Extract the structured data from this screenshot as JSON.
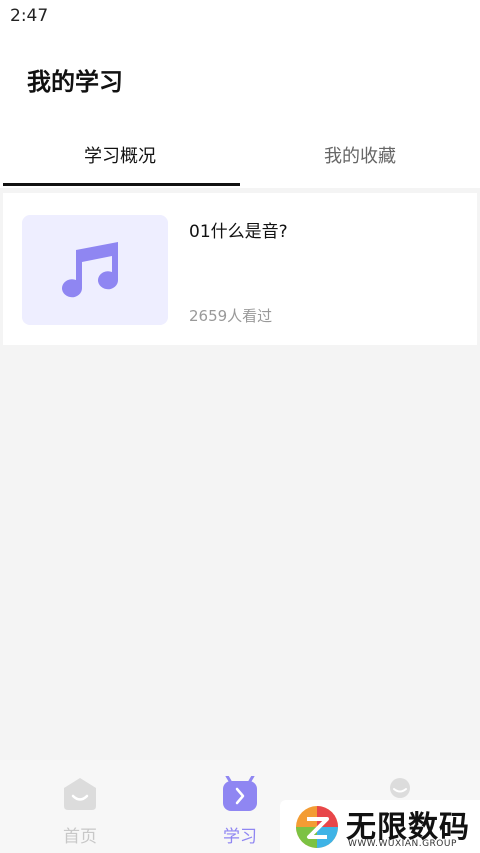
{
  "status_bar": {
    "time": "2:47"
  },
  "header": {
    "title": "我的学习"
  },
  "tabs": [
    {
      "label": "学习概况",
      "active": true
    },
    {
      "label": "我的收藏",
      "active": false
    }
  ],
  "courses": [
    {
      "title": "01什么是音?",
      "views": "2659人看过",
      "icon": "music-note-icon"
    }
  ],
  "bottom_nav": [
    {
      "label": "首页",
      "icon": "home-icon"
    },
    {
      "label": "学习",
      "icon": "study-icon",
      "active": true
    },
    {
      "label": "",
      "icon": "profile-icon"
    }
  ],
  "watermark": {
    "text": "无限数码",
    "subtext": "WWW.WUXIAN.GROUP"
  },
  "colors": {
    "accent": "#8f86f2",
    "thumb_bg": "#eeeeff",
    "background": "#f4f4f4"
  }
}
